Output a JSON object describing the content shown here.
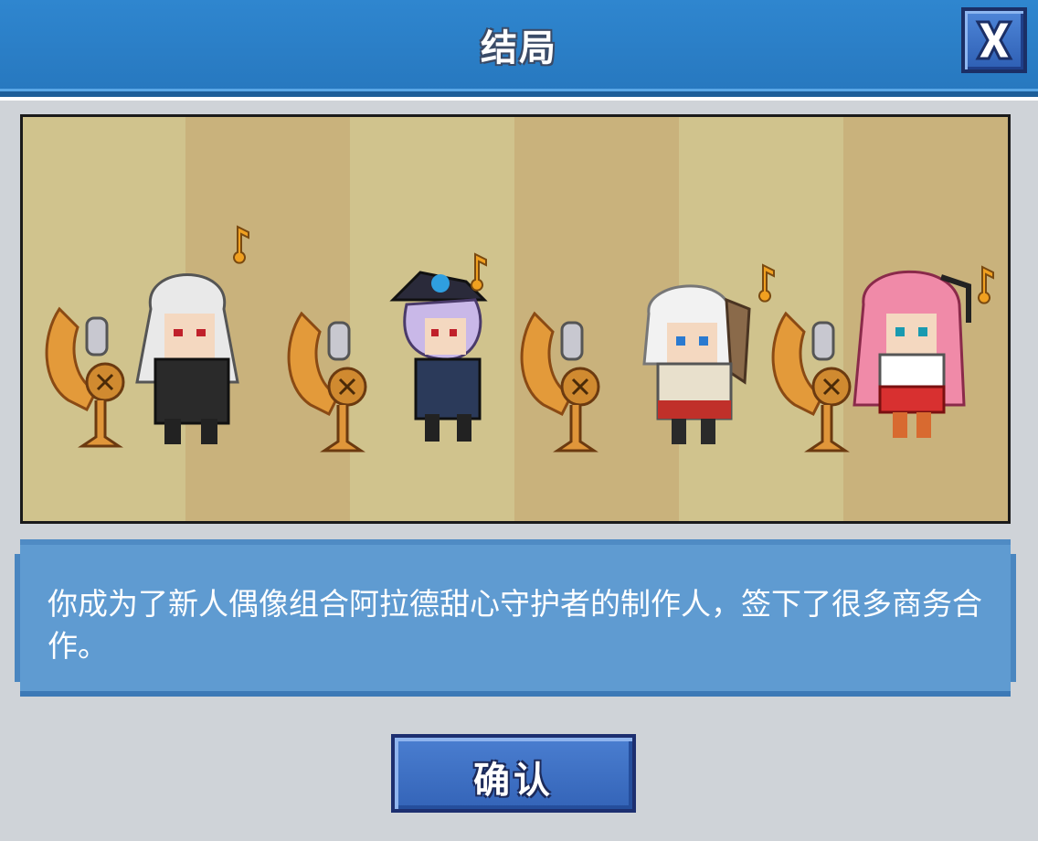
{
  "dialog": {
    "title": "结局",
    "close_icon": "close-x-icon",
    "ending_text": "你成为了新人偶像组合阿拉德甜心守护者的制作人，签下了很多商务合作。",
    "confirm_label": "确认"
  },
  "scene": {
    "characters": [
      {
        "name": "idol-white-hair-black-dress",
        "hair_color": "#eeeeee",
        "outfit_color": "#2a2a2a"
      },
      {
        "name": "idol-lavender-hair-witch-hat",
        "hair_color": "#c9b8e8",
        "outfit_color": "#2b3a5a"
      },
      {
        "name": "idol-silver-hair-ponytail",
        "hair_color": "#f2f2f2",
        "outfit_color": "#e8e0cc"
      },
      {
        "name": "idol-pink-hair-red-skirt",
        "hair_color": "#f08aa8",
        "outfit_color": "#d83030"
      }
    ],
    "props": [
      "golden-microphone-stand",
      "golden-microphone-stand",
      "golden-microphone-stand",
      "golden-microphone-stand"
    ],
    "note_icon": "music-note-icon"
  },
  "colors": {
    "header": "#2f86cf",
    "panel": "#5f9bd1",
    "button": "#3f72c4"
  }
}
